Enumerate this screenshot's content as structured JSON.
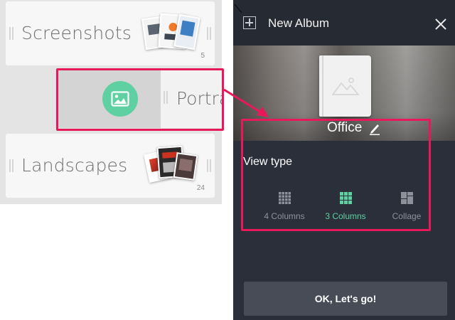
{
  "albums": [
    {
      "name": "Screenshots",
      "count": "5"
    },
    {
      "name": "Landscapes",
      "count": "24"
    }
  ],
  "dragging_album": {
    "name": "Portra"
  },
  "panel": {
    "title": "New Album",
    "album_name": "Office",
    "view_type_label": "View type",
    "view_options": [
      {
        "label": "4 Columns",
        "icon": "grid-4-icon",
        "selected": false
      },
      {
        "label": "3 Columns",
        "icon": "grid-3-icon",
        "selected": true
      },
      {
        "label": "Collage",
        "icon": "collage-icon",
        "selected": false
      }
    ],
    "confirm_label": "OK, Let's go!"
  },
  "colors": {
    "highlight": "#e8195a",
    "accent": "#5ed0a2",
    "panel_bg": "#2b2f3a",
    "button_bg": "#474c57"
  }
}
